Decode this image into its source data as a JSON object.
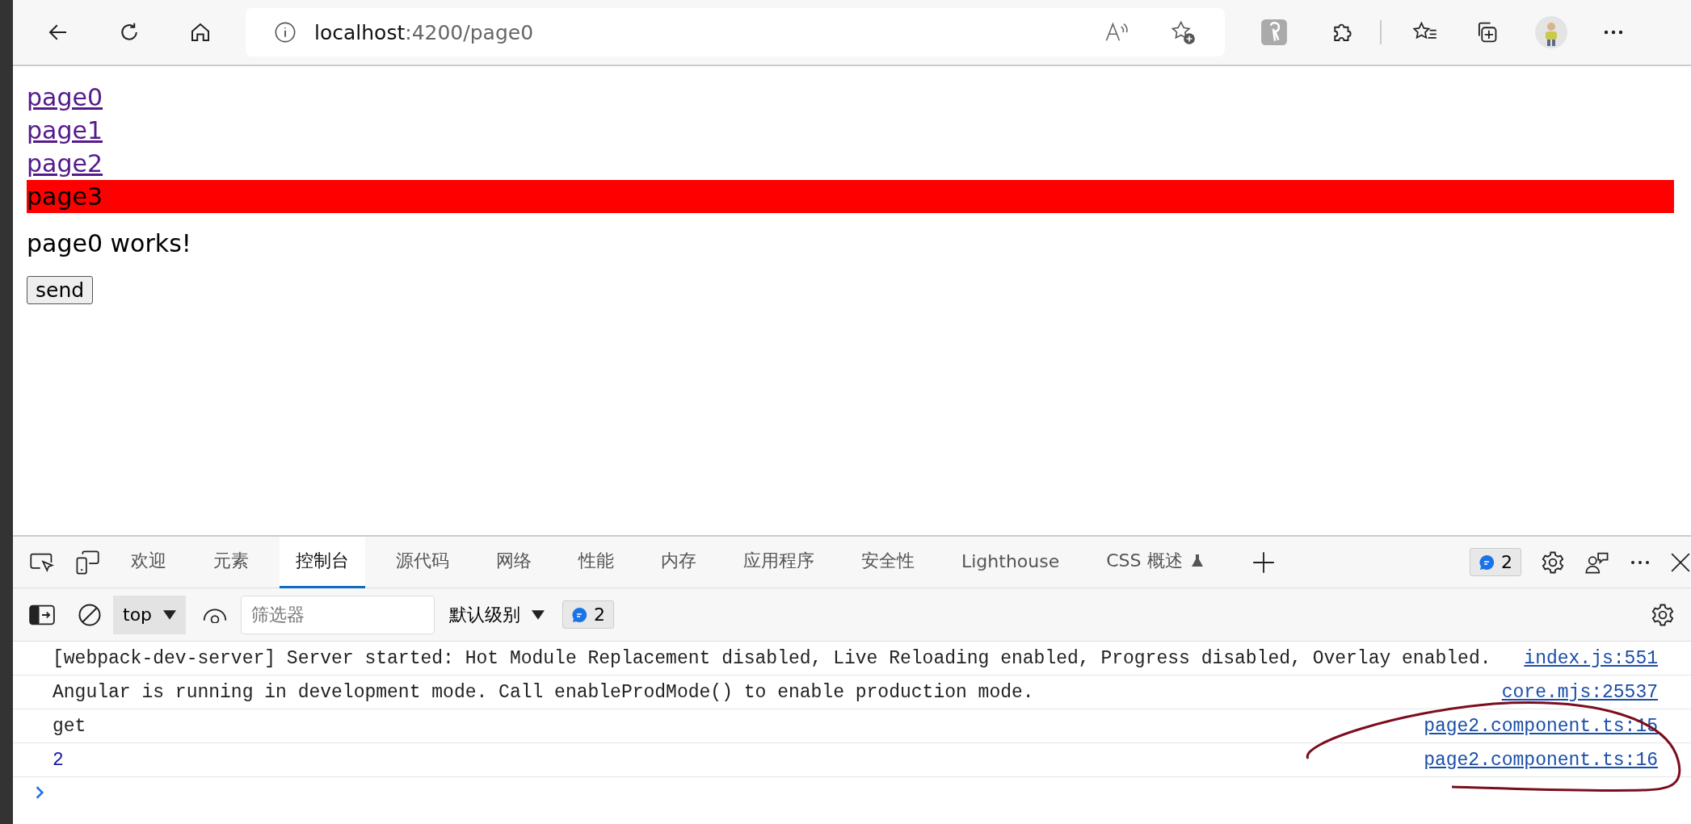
{
  "browser": {
    "address_host": "localhost",
    "address_path": ":4200/page0"
  },
  "page": {
    "links": [
      {
        "label": "page0",
        "active": false
      },
      {
        "label": "page1",
        "active": false
      },
      {
        "label": "page2",
        "active": false
      },
      {
        "label": "page3",
        "active": true
      }
    ],
    "heading": "page0 works!",
    "button": "send"
  },
  "devtools": {
    "tabs": [
      {
        "label": "欢迎",
        "selected": false
      },
      {
        "label": "元素",
        "selected": false
      },
      {
        "label": "控制台",
        "selected": true
      },
      {
        "label": "源代码",
        "selected": false
      },
      {
        "label": "网络",
        "selected": false
      },
      {
        "label": "性能",
        "selected": false
      },
      {
        "label": "内存",
        "selected": false
      },
      {
        "label": "应用程序",
        "selected": false
      },
      {
        "label": "安全性",
        "selected": false
      },
      {
        "label": "Lighthouse",
        "selected": false
      },
      {
        "label": "CSS 概述",
        "selected": false
      }
    ],
    "issues_count": "2",
    "toolbar": {
      "context": "top",
      "filter_placeholder": "筛选器",
      "level": "默认级别",
      "message_count": "2"
    },
    "messages": [
      {
        "kind": "text",
        "text": "[webpack-dev-server] Server started: Hot Module Replacement disabled, Live Reloading enabled, Progress disabled, Overlay enabled.",
        "source": "index.js:551"
      },
      {
        "kind": "text",
        "text": "Angular is running in development mode. Call enableProdMode() to enable production mode.",
        "source": "core.mjs:25537"
      },
      {
        "kind": "text",
        "text": "get",
        "source": "page2.component.ts:15"
      },
      {
        "kind": "number",
        "text": "2",
        "source": "page2.component.ts:16"
      }
    ]
  }
}
